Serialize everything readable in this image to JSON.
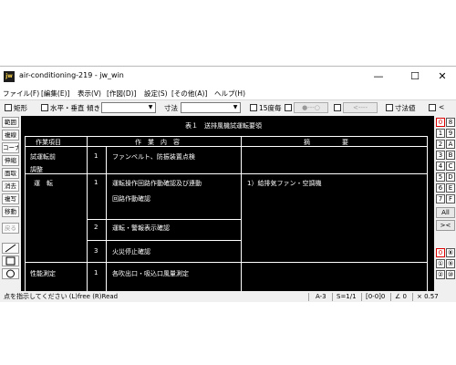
{
  "window": {
    "title": "air-conditioning-219 - jw_win",
    "app_icon": "jw",
    "min": "—",
    "max": "☐",
    "close": "✕"
  },
  "menu": [
    "ファイル(F)",
    "[編集(E)]",
    "表示(V)",
    "[作図(D)]",
    "設定(S)",
    "[その他(A)]",
    "ヘルプ(H)"
  ],
  "toolbar": {
    "rect_label": "矩形",
    "hv_label": "水平・垂直",
    "tilt_label": "傾き",
    "tilt_value": "",
    "dim_label": "寸法",
    "dim_value": "",
    "ratio_label": "15度毎",
    "btn1": "●---○",
    "btn2": "<----",
    "dimval_label": "寸法値",
    "last_label": "<"
  },
  "left_tools": [
    "範囲",
    "複線",
    "コーナー",
    "伸縮",
    "面取",
    "消去",
    "複写",
    "移動",
    "戻る"
  ],
  "right_tools": [
    [
      "0",
      "8"
    ],
    [
      "1",
      "9"
    ],
    [
      "2",
      "A"
    ],
    [
      "3",
      "B"
    ],
    [
      "4",
      "C"
    ],
    [
      "5",
      "D"
    ],
    [
      "6",
      "E"
    ],
    [
      "7",
      "F"
    ]
  ],
  "right_extra": {
    "all": "All",
    "x": "><",
    "c0": "0",
    "c8": "⑧",
    "c1": "①",
    "c9": "⑨",
    "c2": "②",
    "c10": "⑩"
  },
  "drawing": {
    "title": "表１　送排風機試運転要領",
    "headers": [
      "作業項目",
      "作　業　内　容",
      "摘　　　　　要"
    ],
    "rows": [
      {
        "item": "試運転前",
        "no": "1",
        "content": "ファンベルト、防振装置点検",
        "note": ""
      },
      {
        "item": "調整",
        "no": "",
        "content": "",
        "note": ""
      },
      {
        "item": "運　転",
        "no": "1",
        "content": "運転操作回路作動確認及び連動",
        "note": "1）給排気ファン・空調機"
      },
      {
        "item": "",
        "no": "",
        "content": "回路作動確認",
        "note": ""
      },
      {
        "item": "",
        "no": "2",
        "content": "運転・警報表示確認",
        "note": ""
      },
      {
        "item": "",
        "no": "3",
        "content": "火災停止確認",
        "note": ""
      },
      {
        "item": "性能測定",
        "no": "1",
        "content": "各吹出口・吸込口風量測定",
        "note": ""
      }
    ]
  },
  "status": {
    "message": "点を指示してください (L)free (R)Read",
    "layer": "A-3",
    "scale": "S=1/1",
    "group": "[0-0]0",
    "angle": "∠ 0",
    "zoom": "× 0.57"
  }
}
